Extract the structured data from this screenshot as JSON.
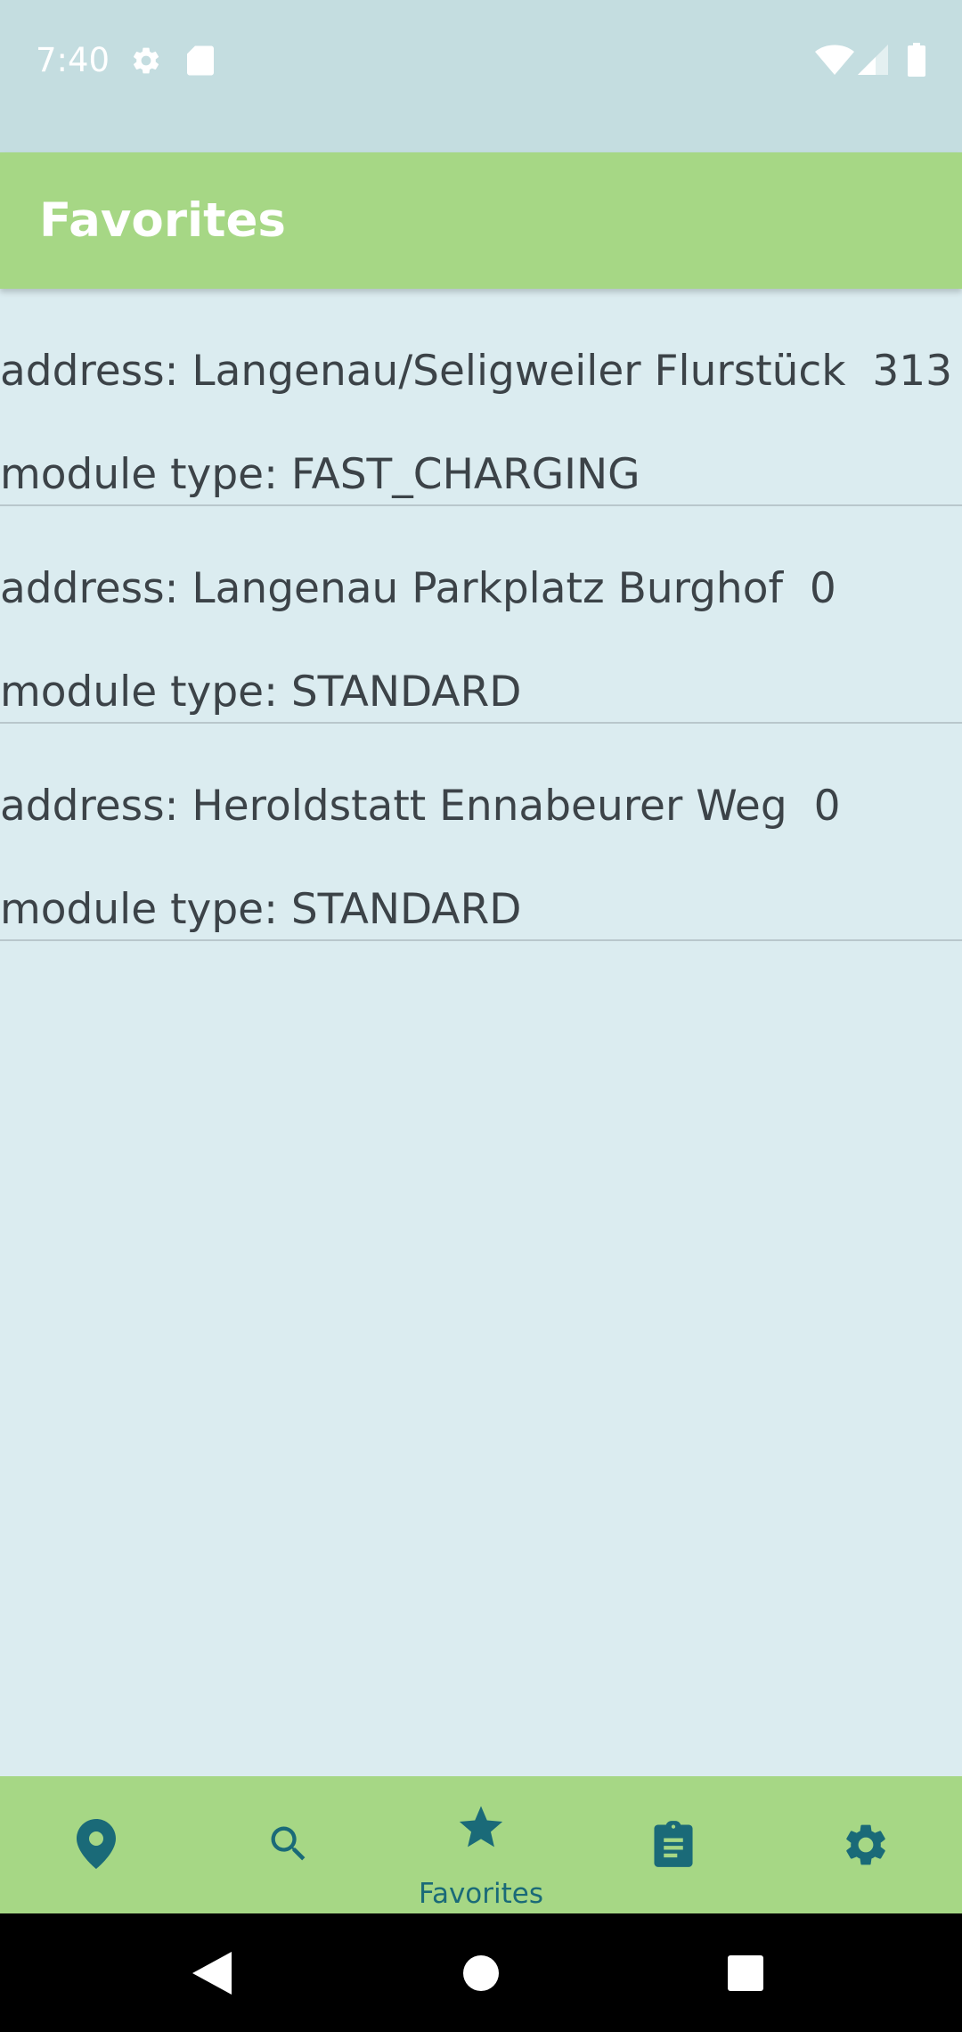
{
  "status_bar": {
    "time": "7:40",
    "icons": [
      "gear-icon",
      "sd-card-icon",
      "wifi-icon",
      "cell-signal-icon",
      "battery-icon"
    ]
  },
  "app_bar": {
    "title": "Favorites"
  },
  "favorites": [
    {
      "address": "address: Langenau/Seligweiler Flurstück  313",
      "module_type": "module type: FAST_CHARGING"
    },
    {
      "address": "address: Langenau Parkplatz Burghof  0",
      "module_type": "module type: STANDARD"
    },
    {
      "address": "address: Heroldstatt Ennabeurer Weg  0",
      "module_type": "module type: STANDARD"
    }
  ],
  "bottom_nav": {
    "items": [
      {
        "icon": "map-pin-icon",
        "label": ""
      },
      {
        "icon": "search-icon",
        "label": ""
      },
      {
        "icon": "star-icon",
        "label": "Favorites",
        "selected": true
      },
      {
        "icon": "clipboard-icon",
        "label": ""
      },
      {
        "icon": "gear-icon",
        "label": ""
      }
    ]
  },
  "colors": {
    "app_bar": "#a6d785",
    "background": "#dbecf0",
    "status_bar": "#c4dde0",
    "nav_icon": "#1a6a78",
    "text": "#3c4348"
  }
}
